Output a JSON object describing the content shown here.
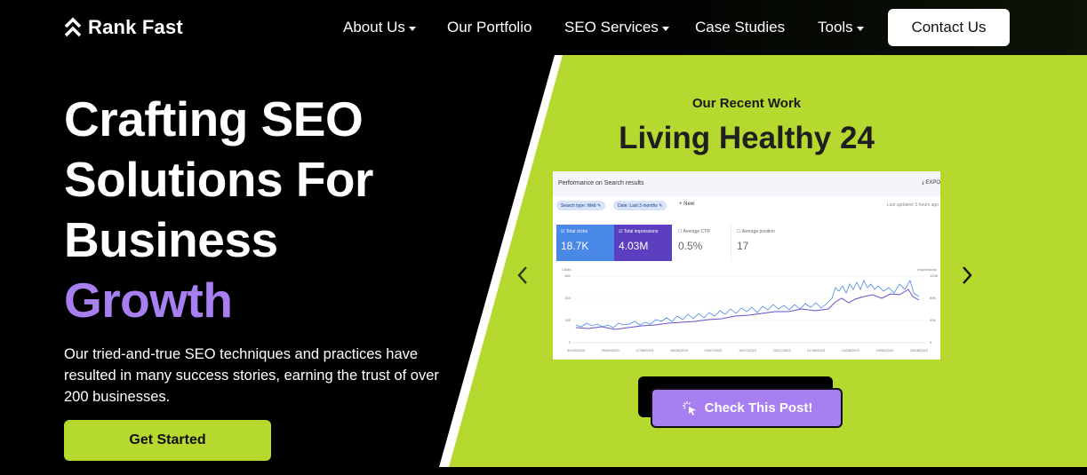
{
  "brand": {
    "name": "Rank Fast",
    "accent": "#a77ff0",
    "lime": "#b5d92f"
  },
  "nav": {
    "about": "About Us",
    "portfolio": "Our Portfolio",
    "seo_services": "SEO Services",
    "case_studies": "Case Studies",
    "tools": "Tools",
    "contact": "Contact Us"
  },
  "hero": {
    "title_line1": "Crafting SEO",
    "title_line2": "Solutions For",
    "title_line3": "Business",
    "title_accent": "Growth",
    "description": "Our tried-and-true SEO techniques and practices have resulted in many success stories, earning the trust of over 200 businesses.",
    "cta": "Get Started"
  },
  "portfolio": {
    "label": "Our Recent Work",
    "project_title": "Living Healthy 24",
    "cta": "Check This Post!",
    "screenshot": {
      "title": "Performance on Search results",
      "export": "EXPO",
      "filter_search_type": "Search type: Web",
      "filter_date": "Date: Last 3 months",
      "new": "New",
      "updated": "Last updated: 5 hours ago",
      "metrics": [
        {
          "label": "Total clicks",
          "value": "18.7K"
        },
        {
          "label": "Total impressions",
          "value": "4.03M"
        },
        {
          "label": "Average CTR",
          "value": "0.5%"
        },
        {
          "label": "Average position",
          "value": "17"
        }
      ],
      "y_left_title": "Clicks",
      "y_right_title": "Impressions",
      "y_left_ticks": [
        "450",
        "300",
        "150",
        "0"
      ],
      "y_right_ticks": [
        "120K",
        "80K",
        "40K",
        "0"
      ],
      "x_ticks": [
        "30/05/2023",
        "09/06/2023",
        "17/06/2023",
        "26/06/2023",
        "05/07/2023",
        "14/07/2023",
        "23/07/2023",
        "01/08/2023",
        "10/08/2023",
        "19/08/2023",
        "28/08/2023"
      ]
    }
  }
}
